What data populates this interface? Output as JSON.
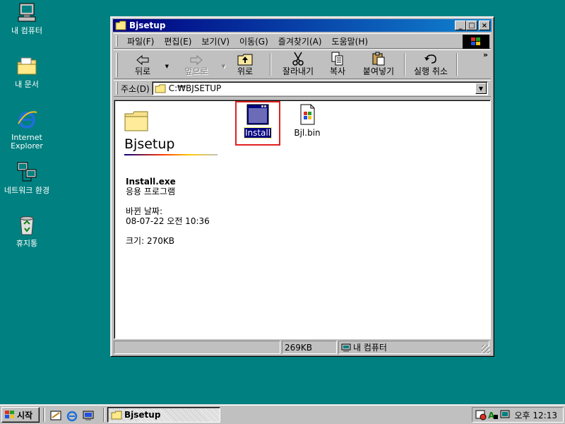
{
  "desktop": {
    "icons": [
      {
        "label": "내 컴퓨터"
      },
      {
        "label": "내 문서"
      },
      {
        "label": "Internet Explorer"
      },
      {
        "label": "네트워크 환경"
      },
      {
        "label": "휴지통"
      }
    ]
  },
  "window": {
    "title": "Bjsetup",
    "controls": {
      "minimize": "_",
      "maximize": "□",
      "close": "×"
    },
    "menu": [
      "파일(F)",
      "편집(E)",
      "보기(V)",
      "이동(G)",
      "즐겨찾기(A)",
      "도움말(H)"
    ],
    "toolbar": {
      "back": "뒤로",
      "forward": "앞으로",
      "up": "위로",
      "cut": "잘라내기",
      "copy": "복사",
      "paste": "붙여넣기",
      "undo": "실행 취소",
      "more": "»"
    },
    "address": {
      "label": "주소(D)",
      "value": "C:₩BJSETUP"
    },
    "webview": {
      "folder_title": "Bjsetup",
      "selected_name": "Install.exe",
      "selected_type": "응용 프로그램",
      "modified_label": "바뀐 날짜:",
      "modified_value": "08-07-22 오전 10:36",
      "size_text": "크기: 270KB"
    },
    "files": [
      {
        "name": "Install",
        "selected": true
      },
      {
        "name": "Bjl.bin",
        "selected": false
      }
    ],
    "status": {
      "size": "269KB",
      "location": "내 컴퓨터"
    }
  },
  "taskbar": {
    "start_label": "시작",
    "task_button": "Bjsetup",
    "clock": "오후 12:13"
  },
  "colors": {
    "desktop": "#008080",
    "titlebar_start": "#000080",
    "titlebar_end": "#1084d0",
    "selection": "#000080",
    "highlight_box": "#e02020"
  }
}
